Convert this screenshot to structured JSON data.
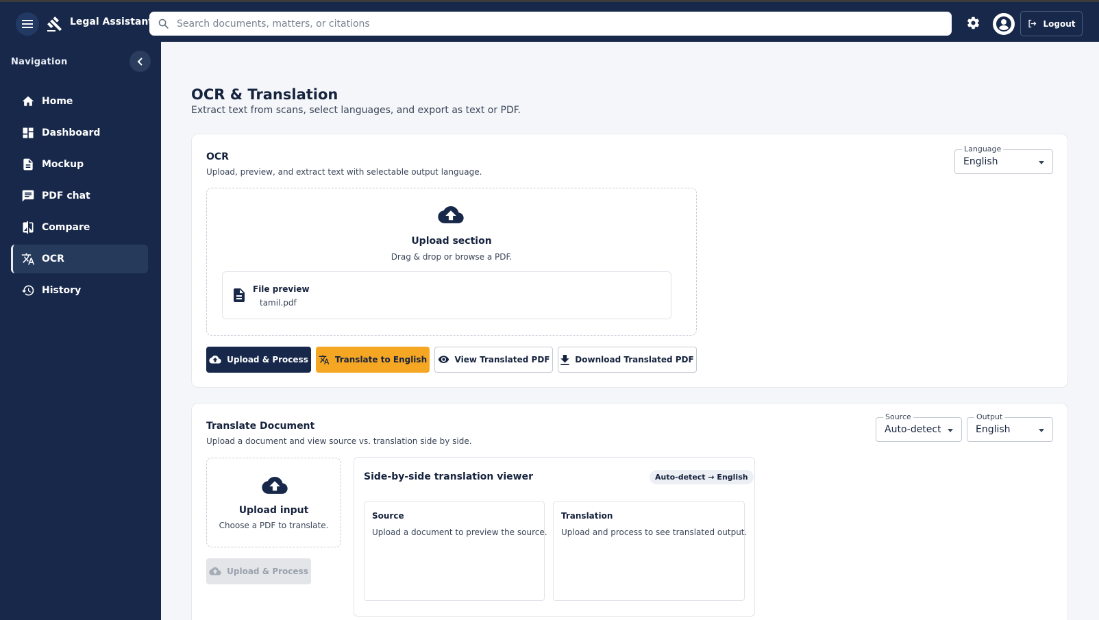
{
  "header": {
    "app_name": "Legal Assistant",
    "search_placeholder": "Search documents, matters, or citations",
    "logout_label": "Logout"
  },
  "sidebar": {
    "title": "Navigation",
    "items": [
      {
        "label": "Home",
        "icon": "home-icon"
      },
      {
        "label": "Dashboard",
        "icon": "dashboard-icon"
      },
      {
        "label": "Mockup",
        "icon": "document-icon"
      },
      {
        "label": "PDF chat",
        "icon": "chat-icon"
      },
      {
        "label": "Compare",
        "icon": "compare-icon"
      },
      {
        "label": "OCR",
        "icon": "translate-icon",
        "active": true
      },
      {
        "label": "History",
        "icon": "history-icon"
      }
    ]
  },
  "page": {
    "title": "OCR & Translation",
    "subtitle": "Extract text from scans, select languages, and export as text or PDF."
  },
  "ocr": {
    "title": "OCR",
    "subtitle": "Upload, preview, and extract text with selectable output language.",
    "language_label": "Language",
    "language_value": "English",
    "upload_title": "Upload section",
    "upload_sub": "Drag & drop or browse a PDF.",
    "preview_title": "File preview",
    "preview_file": "tamil.pdf",
    "buttons": {
      "upload_process": "Upload & Process",
      "translate": "Translate to English",
      "view_pdf": "View Translated PDF",
      "download_pdf": "Download Translated PDF"
    }
  },
  "translate": {
    "title": "Translate Document",
    "subtitle": "Upload a document and view source vs. translation side by side.",
    "source_label": "Source",
    "source_value": "Auto-detect",
    "output_label": "Output",
    "output_value": "English",
    "upload_title": "Upload input",
    "upload_sub": "Choose a PDF to translate.",
    "upload_button": "Upload & Process",
    "viewer_title": "Side-by-side translation viewer",
    "chip": "Auto-detect → English",
    "source_pane_title": "Source",
    "source_pane_text": "Upload a document to preview the source.",
    "translation_pane_title": "Translation",
    "translation_pane_text": "Upload and process to see translated output."
  },
  "colors": {
    "navy": "#17284a",
    "accent": "#f5a623",
    "background": "#f4f6f9"
  }
}
